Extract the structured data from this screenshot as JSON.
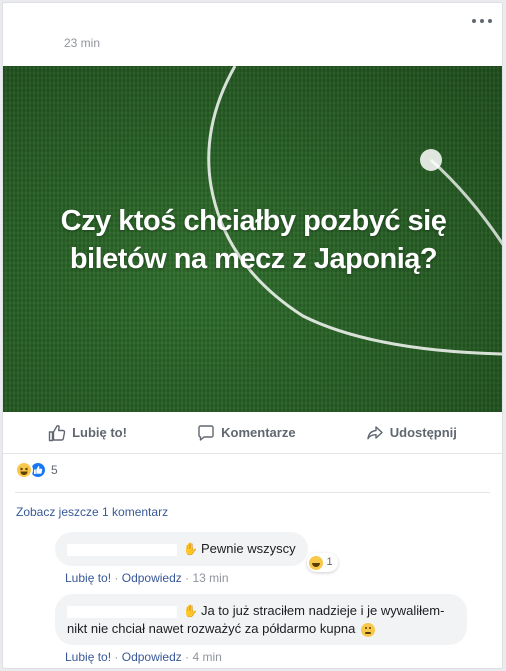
{
  "post": {
    "timestamp": "23 min",
    "image_headline": "Czy ktoś chciałby pozbyć się biletów na mecz z Japonią?"
  },
  "actions": {
    "like": "Lubię to!",
    "comment": "Komentarze",
    "share": "Udostępnij"
  },
  "reactions": {
    "count": "5",
    "types": [
      "haha",
      "like"
    ]
  },
  "comments_section": {
    "see_more": "Zobacz jeszcze 1 komentarz",
    "comments": [
      {
        "text": "Pewnie wszyscy",
        "reaction_count": "1",
        "like_label": "Lubię to!",
        "reply_label": "Odpowiedz",
        "time": "13 min"
      },
      {
        "text_line1": "Ja to już straciłem nadzieje i je wywaliłem-",
        "text_line2": "nikt nie chciał nawet rozważyć za półdarmo kupna",
        "like_label": "Lubię to!",
        "reply_label": "Odpowiedz",
        "time": "4 min"
      }
    ]
  },
  "colors": {
    "link": "#385898",
    "muted": "#90949c",
    "grass": "#275f25",
    "bubble": "#f2f3f5"
  }
}
